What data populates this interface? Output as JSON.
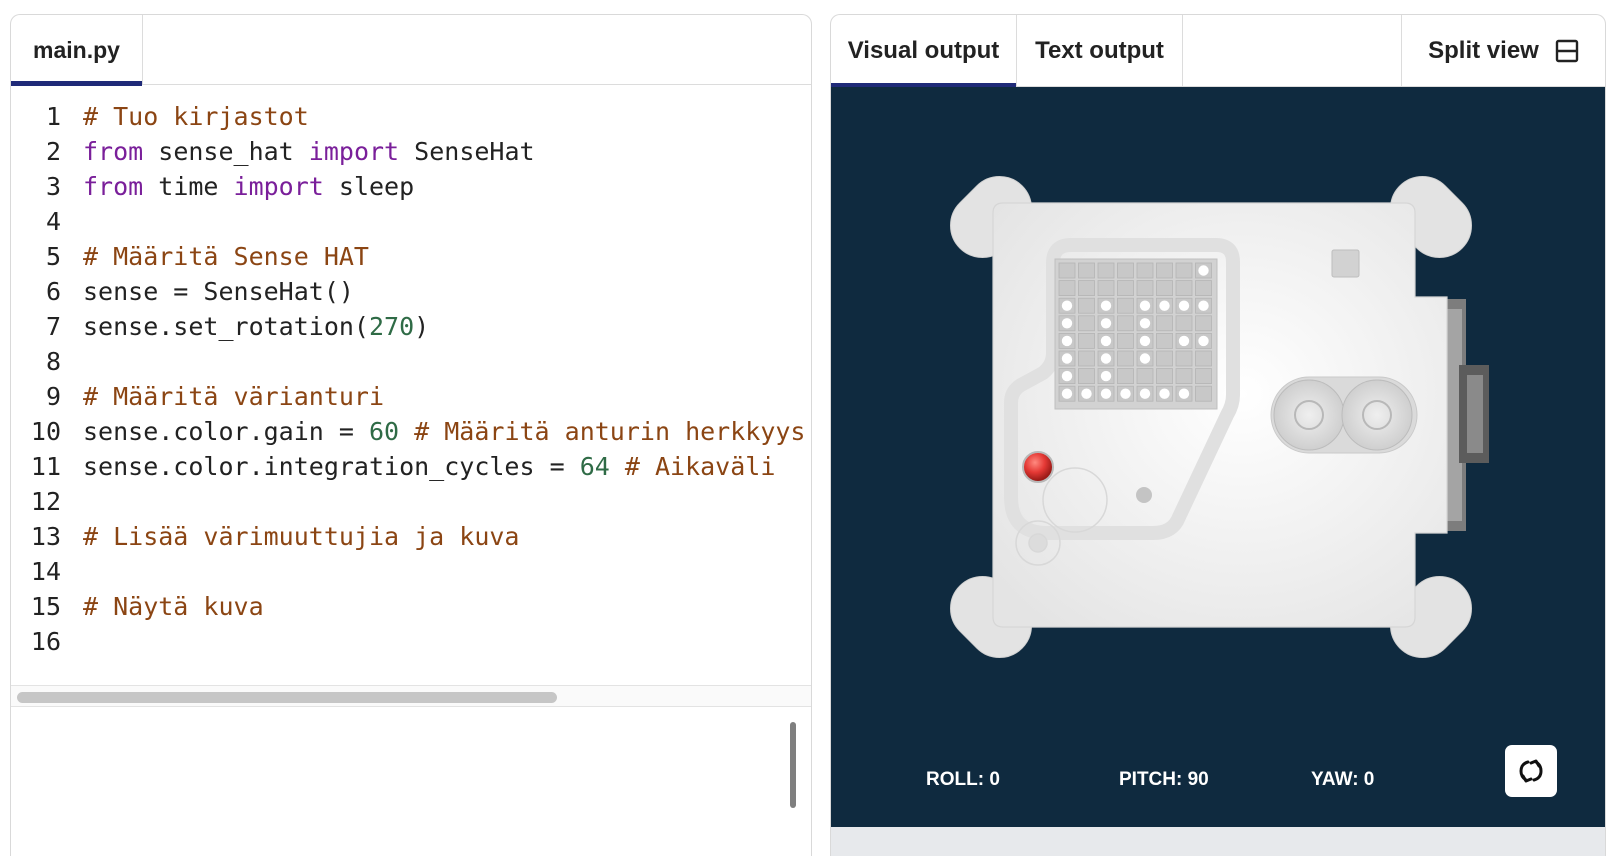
{
  "editor": {
    "file_tab": "main.py",
    "lines": [
      {
        "num": "1",
        "parts": [
          {
            "t": "# Tuo kirjastot",
            "c": "cm"
          }
        ]
      },
      {
        "num": "2",
        "parts": [
          {
            "t": "from",
            "c": "kw"
          },
          {
            "t": " sense_hat ",
            "c": ""
          },
          {
            "t": "import",
            "c": "kw"
          },
          {
            "t": " SenseHat",
            "c": ""
          }
        ]
      },
      {
        "num": "3",
        "parts": [
          {
            "t": "from",
            "c": "kw"
          },
          {
            "t": " time ",
            "c": ""
          },
          {
            "t": "import",
            "c": "kw"
          },
          {
            "t": " sleep",
            "c": ""
          }
        ]
      },
      {
        "num": "4",
        "parts": []
      },
      {
        "num": "5",
        "parts": [
          {
            "t": "# Määritä Sense HAT",
            "c": "cm"
          }
        ]
      },
      {
        "num": "6",
        "parts": [
          {
            "t": "sense = SenseHat()",
            "c": ""
          }
        ]
      },
      {
        "num": "7",
        "parts": [
          {
            "t": "sense.set_rotation(",
            "c": ""
          },
          {
            "t": "270",
            "c": "nm"
          },
          {
            "t": ")",
            "c": ""
          }
        ]
      },
      {
        "num": "8",
        "parts": []
      },
      {
        "num": "9",
        "parts": [
          {
            "t": "# Määritä värianturi",
            "c": "cm"
          }
        ]
      },
      {
        "num": "10",
        "parts": [
          {
            "t": "sense.color.gain = ",
            "c": ""
          },
          {
            "t": "60",
            "c": "nm"
          },
          {
            "t": " # Määritä anturin herkkyys",
            "c": "cm"
          }
        ]
      },
      {
        "num": "11",
        "parts": [
          {
            "t": "sense.color.integration_cycles = ",
            "c": ""
          },
          {
            "t": "64",
            "c": "nm"
          },
          {
            "t": " # Aikaväli",
            "c": "cm"
          }
        ]
      },
      {
        "num": "12",
        "parts": []
      },
      {
        "num": "13",
        "parts": [
          {
            "t": "# Lisää värimuuttujia ja kuva",
            "c": "cm"
          }
        ]
      },
      {
        "num": "14",
        "parts": []
      },
      {
        "num": "15",
        "parts": [
          {
            "t": "# Näytä kuva",
            "c": "cm"
          }
        ]
      },
      {
        "num": "16",
        "parts": []
      }
    ]
  },
  "output": {
    "tabs": [
      {
        "label": "Visual output",
        "active": true
      },
      {
        "label": "Text output",
        "active": false
      }
    ],
    "split_view_label": "Split view",
    "readouts": {
      "roll": "ROLL: 0",
      "pitch": "PITCH: 90",
      "yaw": "YAW: 0"
    },
    "led_matrix": [
      "00000001",
      "00000000",
      "10101111",
      "10101000",
      "10101011",
      "10101000",
      "10100000",
      "11111110"
    ],
    "colors": {
      "canvas_bg": "#0f2a3f",
      "tab_accent": "#1f2a78",
      "comment": "#8b4513",
      "keyword": "#7a1f9a",
      "number": "#2f6b46",
      "joystick_led": "#e53935"
    }
  }
}
